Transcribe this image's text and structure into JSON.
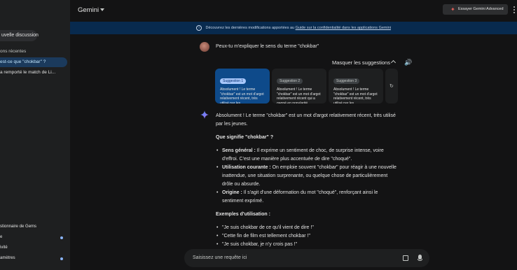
{
  "app": {
    "title": "Gemini"
  },
  "header": {
    "advanced_label": "Essayer Gemini Advanced"
  },
  "banner": {
    "text": "Découvrez les dernières modifications apportées au",
    "link": "Guide sur la confidentialité dans les applications Gemini"
  },
  "sidebar": {
    "new_chat": "uvelle discussion",
    "recent_label": "ons récentes",
    "items": [
      {
        "label": "est-ce que \"chokbar\" ?"
      },
      {
        "label": "a remporté le match de Li..."
      }
    ],
    "bottom": [
      {
        "label": "stionnaire de Gems"
      },
      {
        "label": "e"
      },
      {
        "label": "ivité"
      },
      {
        "label": "amètres"
      }
    ]
  },
  "chat": {
    "user_question": "Peux-tu m'expliquer le sens du terme \"chokbar\"",
    "hide_suggestions": "Masquer les suggestions",
    "suggestions": [
      {
        "tag": "Suggestion 1",
        "text": "Absolument ! Le terme \"chokbar\" est un mot d'argot relativement récent, très utilisé par les"
      },
      {
        "tag": "Suggestion 2",
        "text": "Absolument ! Le terme \"chokbar\" est un mot d'argot relativement récent qui a gagné en popularité,"
      },
      {
        "tag": "Suggestion 3",
        "text": "Absolument ! Le terme \"chokbar\" est un mot d'argot relativement récent, très utilisé par les"
      }
    ],
    "response": {
      "intro": "Absolument ! Le terme \"chokbar\" est un mot d'argot relativement récent, très utilisé par les jeunes.",
      "heading1": "Que signifie \"chokbar\" ?",
      "bullets": [
        {
          "bold": "Sens général :",
          "text": " Il exprime un sentiment de choc, de surprise intense, voire d'effroi. C'est une manière plus accentuée de dire \"choqué\"."
        },
        {
          "bold": "Utilisation courante :",
          "text": " On emploie souvent \"chokbar\" pour réagir à une nouvelle inattendue, une situation surprenante, ou quelque chose de particulièrement drôle ou absurde."
        },
        {
          "bold": "Origine :",
          "text": " Il s'agit d'une déformation du mot \"choqué\", renforçant ainsi le sentiment exprimé."
        }
      ],
      "heading2": "Exemples d'utilisation :",
      "examples": [
        "\"Je suis chokbar de ce qu'il vient de dire !\"",
        "\"Cette fin de film est tellement chokbar !\"",
        "\"Je suis chokbar, je n'y crois pas !\""
      ]
    }
  },
  "input": {
    "placeholder": "Saisissez une requête ici"
  },
  "colors": {
    "accent": "#8ab4f8",
    "banner_bg": "#082a4e",
    "active_card": "#0e4a8a"
  }
}
